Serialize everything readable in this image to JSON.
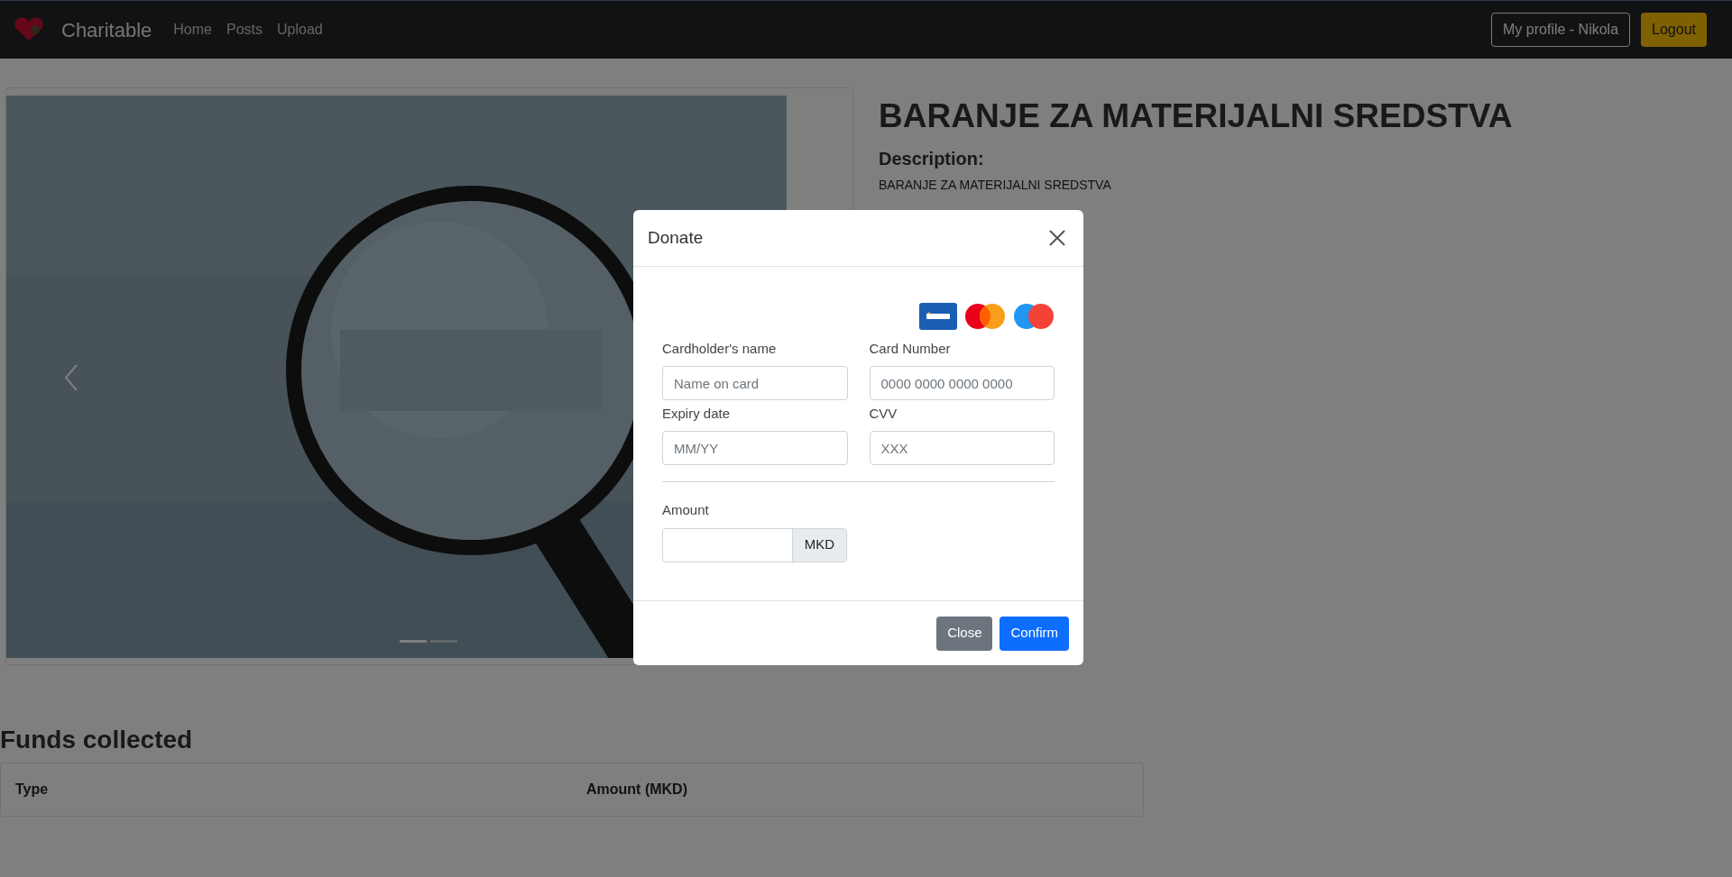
{
  "navbar": {
    "brand": "Charitable",
    "links": [
      "Home",
      "Posts",
      "Upload"
    ],
    "profile_button": "My profile - Nikola",
    "logout_button": "Logout"
  },
  "carousel": {
    "indicators": [
      {
        "selected": true
      },
      {
        "selected": false
      }
    ]
  },
  "post": {
    "title": "BARANJE ZA MATERIJALNI SREDSTVA",
    "description_label": "Description:",
    "description": "BARANJE ZA MATERIJALNI SREDSTVA"
  },
  "funds": {
    "heading": "Funds collected",
    "columns": [
      "Type",
      "Amount (MKD)"
    ]
  },
  "modal": {
    "title": "Donate",
    "fields": [
      {
        "label": "Cardholder's name",
        "placeholder": "Name on card"
      },
      {
        "label": "Card Number",
        "placeholder": "0000 0000 0000 0000"
      },
      {
        "label": "Expiry date",
        "placeholder": "MM/YY"
      },
      {
        "label": "CVV",
        "placeholder": "XXX"
      }
    ],
    "amount": {
      "label": "Amount",
      "addon": "MKD"
    },
    "buttons": [
      {
        "label": "Close",
        "kind": "secondary"
      },
      {
        "label": "Confirm",
        "kind": "primary"
      }
    ]
  }
}
